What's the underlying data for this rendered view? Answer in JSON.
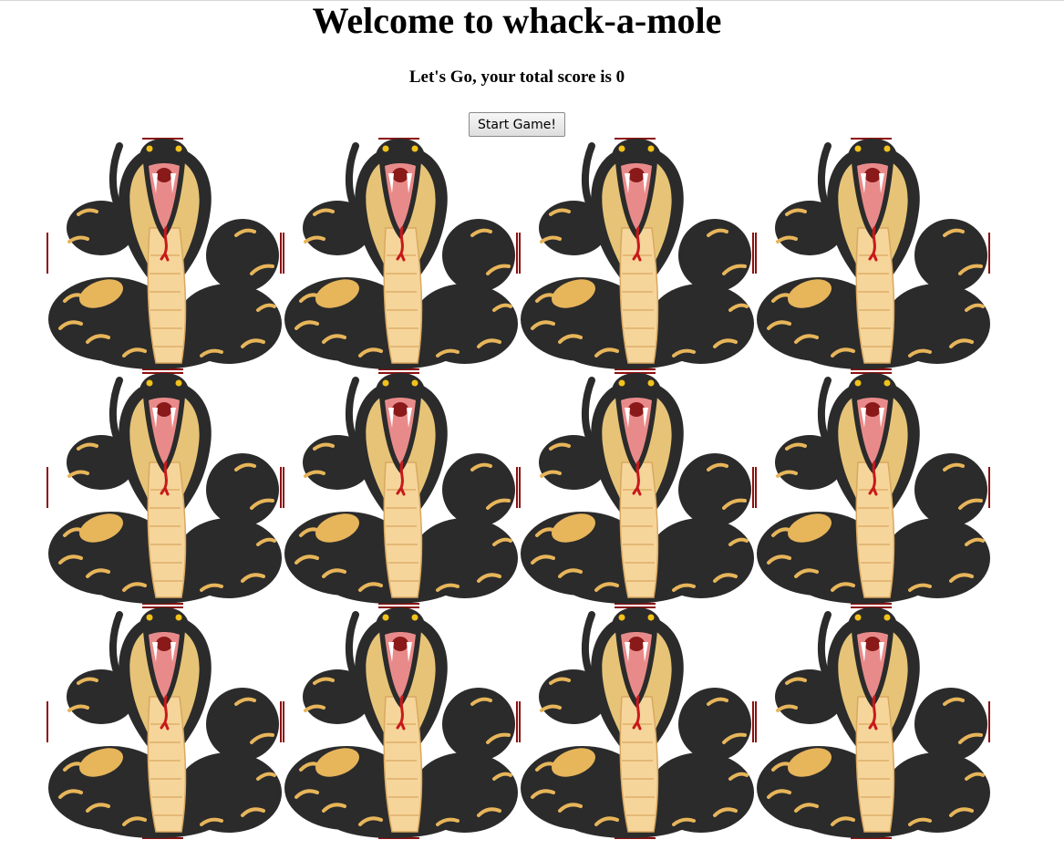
{
  "page": {
    "title": "Welcome to whack-a-mole",
    "score_text": "Let's Go, your total score is 0",
    "start_button_label": "Start Game!"
  },
  "game": {
    "score": 0,
    "rows": 3,
    "columns": 4,
    "hole_image": "cobra-snake",
    "colors": {
      "snake_body": "#2b2b2b",
      "snake_bands": "#e7b55a",
      "hood": "#e6c377",
      "belly": "#f6d59a",
      "mouth": "#e98a8a",
      "tongue": "#c8191b",
      "eyes": "#f2c21b",
      "frame_mark": "#8b1010"
    }
  }
}
